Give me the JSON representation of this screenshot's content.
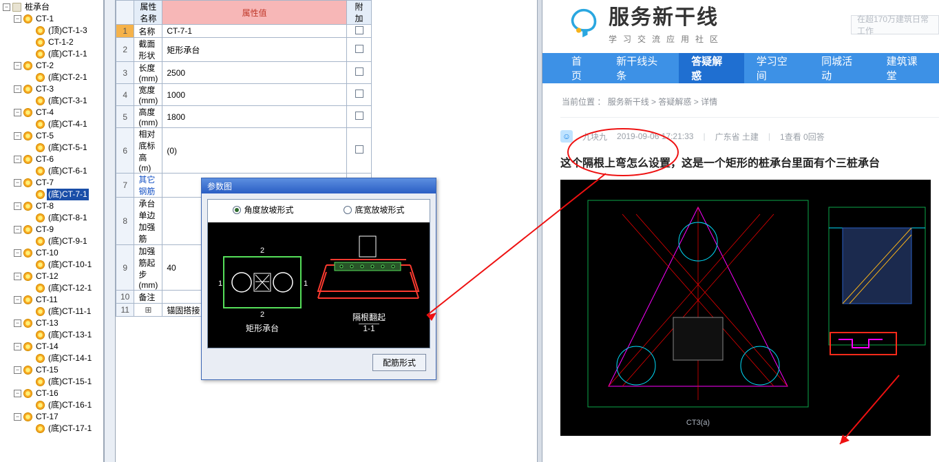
{
  "tree": {
    "root_label": "桩承台",
    "groups": [
      {
        "label": "CT-1",
        "children": [
          "(顶)CT-1-3",
          "CT-1-2",
          "(底)CT-1-1"
        ]
      },
      {
        "label": "CT-2",
        "children": [
          "(底)CT-2-1"
        ]
      },
      {
        "label": "CT-3",
        "children": [
          "(底)CT-3-1"
        ]
      },
      {
        "label": "CT-4",
        "children": [
          "(底)CT-4-1"
        ]
      },
      {
        "label": "CT-5",
        "children": [
          "(底)CT-5-1"
        ]
      },
      {
        "label": "CT-6",
        "children": [
          "(底)CT-6-1"
        ]
      },
      {
        "label": "CT-7",
        "children": [
          "(底)CT-7-1"
        ],
        "selected_child": 0
      },
      {
        "label": "CT-8",
        "children": [
          "(底)CT-8-1"
        ]
      },
      {
        "label": "CT-9",
        "children": [
          "(底)CT-9-1"
        ]
      },
      {
        "label": "CT-10",
        "children": [
          "(底)CT-10-1"
        ]
      },
      {
        "label": "CT-12",
        "children": [
          "(底)CT-12-1"
        ]
      },
      {
        "label": "CT-11",
        "children": [
          "(底)CT-11-1"
        ]
      },
      {
        "label": "CT-13",
        "children": [
          "(底)CT-13-1"
        ]
      },
      {
        "label": "CT-14",
        "children": [
          "(底)CT-14-1"
        ]
      },
      {
        "label": "CT-15",
        "children": [
          "(底)CT-15-1"
        ]
      },
      {
        "label": "CT-16",
        "children": [
          "(底)CT-16-1"
        ]
      },
      {
        "label": "CT-17",
        "children": [
          "(底)CT-17-1"
        ]
      }
    ]
  },
  "prop": {
    "headers": {
      "name": "属性名称",
      "value": "属性值",
      "extra": "附加"
    },
    "rows": [
      {
        "n": "1",
        "name": "名称",
        "value": "CT-7-1",
        "sel": true
      },
      {
        "n": "2",
        "name": "截面形状",
        "value": "矩形承台"
      },
      {
        "n": "3",
        "name": "长度(mm)",
        "value": "2500"
      },
      {
        "n": "4",
        "name": "宽度(mm)",
        "value": "1000"
      },
      {
        "n": "5",
        "name": "高度(mm)",
        "value": "1800"
      },
      {
        "n": "6",
        "name": "相对底标高(m)",
        "value": "(0)"
      },
      {
        "n": "7",
        "name": "其它钢筋",
        "value": "",
        "blue": true,
        "nochk": true
      },
      {
        "n": "8",
        "name": "承台单边加强筋",
        "value": ""
      },
      {
        "n": "9",
        "name": "加强筋起步(mm)",
        "value": "40"
      },
      {
        "n": "10",
        "name": "备注",
        "value": ""
      },
      {
        "n": "11",
        "name": "锚固搭接",
        "value": "",
        "plus": true,
        "nochk": true
      }
    ]
  },
  "dlg": {
    "title": "参数图",
    "radio1": "角度放坡形式",
    "radio2": "底宽放坡形式",
    "cap_left": "矩形承台",
    "cap_right_top": "隔根翻起",
    "cap_right_bot": "1-1",
    "btn": "配筋形式"
  },
  "web": {
    "brand_name": "服务新干线",
    "brand_sub": "学习交流应用社区",
    "search_placeholder": "在超170万建筑日常工作",
    "nav": [
      "首页",
      "新干线头条",
      "答疑解惑",
      "学习空间",
      "同城活动",
      "建筑课堂"
    ],
    "nav_active": 2,
    "crumb_prefix": "当前位置 ：",
    "crumbs": [
      "服务新干线",
      "答疑解惑",
      "详情"
    ],
    "meta": {
      "user": "九块九",
      "time": "2019-09-06 17:21:33",
      "loc": "广东省  土建",
      "stats": "1查看  0回答"
    },
    "post_title": "这个隔根上弯怎么设置，这是一个矩形的桩承台里面有个三桩承台"
  }
}
